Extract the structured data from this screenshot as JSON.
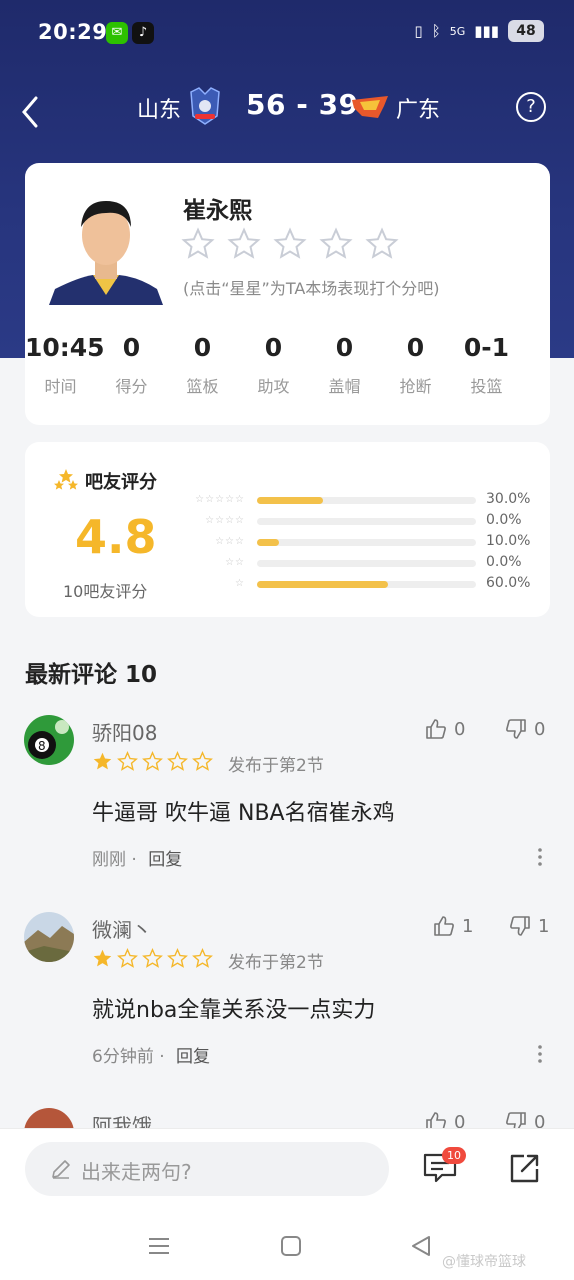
{
  "status_bar": {
    "time": "20:29",
    "network": "5G",
    "battery": "48",
    "app_icons": [
      "wechat-icon",
      "tiktok-icon"
    ]
  },
  "nav": {
    "home_team": "山东",
    "score": "56 - 39",
    "away_team": "广东"
  },
  "player": {
    "name": "崔永熙",
    "rating_hint": "(点击“星星”为TA本场表现打个分吧)",
    "stats": [
      {
        "value": "10:45",
        "label": "时间"
      },
      {
        "value": "0",
        "label": "得分"
      },
      {
        "value": "0",
        "label": "篮板"
      },
      {
        "value": "0",
        "label": "助攻"
      },
      {
        "value": "0",
        "label": "盖帽"
      },
      {
        "value": "0",
        "label": "抢断"
      },
      {
        "value": "0-1",
        "label": "投篮"
      }
    ]
  },
  "rating": {
    "title": "吧友评分",
    "score": "4.8",
    "count_label": "10吧友评分",
    "distribution": [
      {
        "stars": 5,
        "fraction": 0.3,
        "label": "30.0%"
      },
      {
        "stars": 4,
        "fraction": 0.0,
        "label": "0.0%"
      },
      {
        "stars": 3,
        "fraction": 0.1,
        "label": "10.0%"
      },
      {
        "stars": 2,
        "fraction": 0.0,
        "label": "0.0%"
      },
      {
        "stars": 1,
        "fraction": 0.6,
        "label": "60.0%"
      }
    ]
  },
  "comments_title": "最新评论 10",
  "comments": [
    {
      "user": "骄阳08",
      "likes": "0",
      "dislikes": "0",
      "rating": 1,
      "period": "发布于第2节",
      "text": "牛逼哥 吹牛逼 NBA名宿崔永鸡",
      "time": "刚刚",
      "reply": "回复"
    },
    {
      "user": "微澜丶",
      "likes": "1",
      "dislikes": "1",
      "rating": 1,
      "period": "发布于第2节",
      "text": "就说nba全靠关系没一点实力",
      "time": "6分钟前",
      "reply": "回复"
    },
    {
      "user": "阿我饿",
      "likes": "0",
      "dislikes": "0"
    }
  ],
  "bottom": {
    "input_placeholder": "出来走两句?",
    "comment_badge": "10"
  },
  "watermark": "@懂球帝篮球",
  "colors": {
    "header": "#27357e",
    "accent_star": "#f5b72a",
    "bar_fill": "#f3c14a",
    "badge": "#f04a3d"
  }
}
